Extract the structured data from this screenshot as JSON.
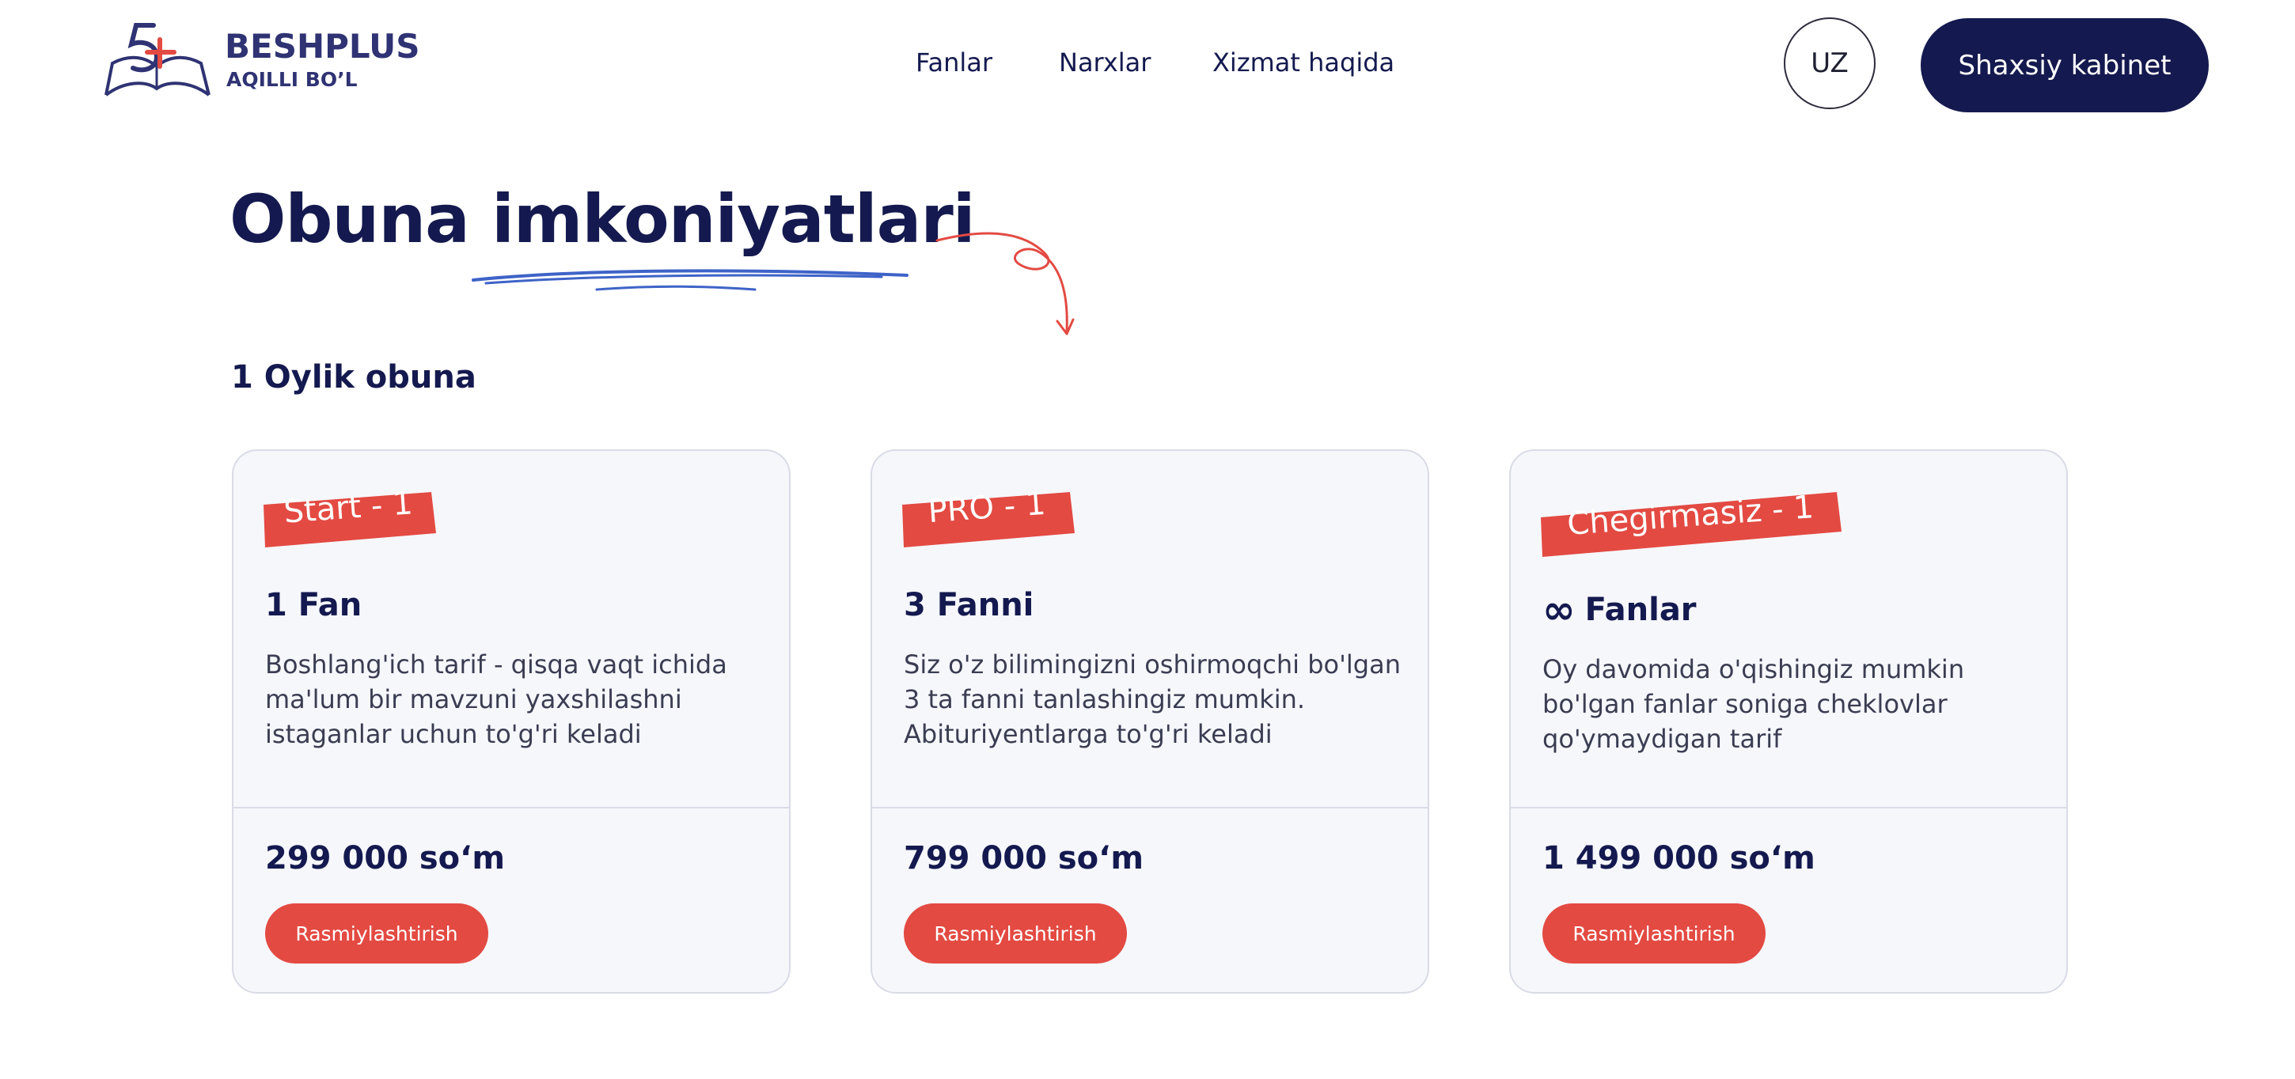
{
  "header": {
    "brand": {
      "name": "BESHPLUS",
      "tagline": "AQILLI BO’L"
    },
    "nav": [
      {
        "label": "Fanlar"
      },
      {
        "label": "Narxlar"
      },
      {
        "label": "Xizmat haqida"
      }
    ],
    "language": "UZ",
    "cabinet_label": "Shaxsiy kabinet"
  },
  "main": {
    "title": "Obuna imkoniyatlari",
    "section_title": "1 Oylik obuna",
    "plans": [
      {
        "tag": "Start - 1",
        "title": "1 Fan",
        "description": "Boshlang'ich tarif - qisqa vaqt ichida ma'lum bir mavzuni yaxshilashni istaganlar uchun to'g'ri keladi",
        "price": "299 000 soʻm",
        "button": "Rasmiylashtirish"
      },
      {
        "tag": "PRO - 1",
        "title": "3 Fanni",
        "description": "Siz o'z bilimingizni oshirmoqchi bo'lgan 3 ta fanni tanlashingiz mumkin. Abituriyentlarga to'g'ri keladi",
        "price": "799 000 soʻm",
        "button": "Rasmiylashtirish"
      },
      {
        "tag": "Chegirmasiz - 1",
        "title_icon": "∞",
        "title": "Fanlar",
        "description": "Oy davomida o'qishingiz mumkin bo'lgan fanlar soniga cheklovlar qo'ymaydigan tarif",
        "price": "1 499 000 soʻm",
        "button": "Rasmiylashtirish"
      }
    ]
  },
  "colors": {
    "primary": "#141a4f",
    "accent": "#e34a42",
    "underline": "#3e63c8",
    "card_bg": "#f6f7fb"
  },
  "icons": {
    "logo": "book-five-plus-logo",
    "underline": "scribble-underline",
    "arrow": "curly-arrow-icon",
    "infinity": "infinity-icon"
  }
}
